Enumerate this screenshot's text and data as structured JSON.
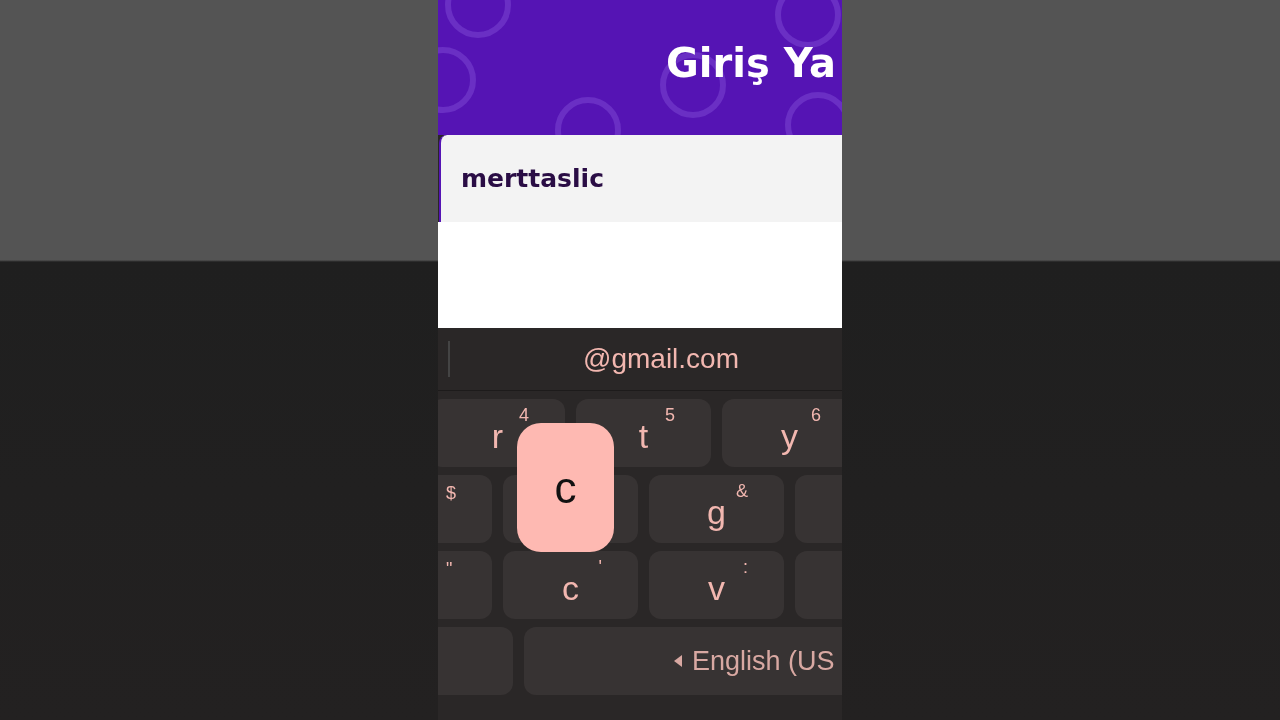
{
  "header": {
    "title": "Giriş Ya"
  },
  "username_field": {
    "value": "merttaslic"
  },
  "keyboard": {
    "suggestion": "@gmail.com",
    "rows": [
      {
        "keys": [
          {
            "kind": "key",
            "label": "r",
            "hint": "4"
          },
          {
            "kind": "key",
            "label": "t",
            "hint": "5"
          },
          {
            "kind": "key",
            "label": "y",
            "hint": "6"
          }
        ]
      },
      {
        "keys": [
          {
            "kind": "key",
            "hint": "$"
          },
          {
            "kind": "key"
          },
          {
            "kind": "key",
            "label": "g",
            "hint": "&"
          },
          {
            "kind": "key"
          }
        ]
      },
      {
        "keys": [
          {
            "kind": "key",
            "hint": "\""
          },
          {
            "kind": "key",
            "label": "c",
            "hint": "'"
          },
          {
            "kind": "key",
            "label": "v",
            "hint": ":"
          },
          {
            "kind": "key"
          }
        ]
      },
      {
        "keys": [
          {
            "kind": "key"
          },
          {
            "kind": "space",
            "label": "English (US"
          }
        ]
      }
    ],
    "popup": {
      "label": "c"
    }
  }
}
